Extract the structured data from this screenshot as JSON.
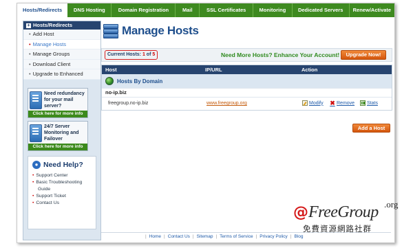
{
  "topnav": {
    "tabs": [
      {
        "label": "Hosts/Redirects",
        "active": true
      },
      {
        "label": "DNS Hosting"
      },
      {
        "label": "Domain Registration"
      },
      {
        "label": "Mail"
      },
      {
        "label": "SSL Certificates"
      },
      {
        "label": "Monitoring"
      },
      {
        "label": "Dedicated Servers"
      },
      {
        "label": "Renew/Activate"
      }
    ]
  },
  "sidebar": {
    "header": "Hosts/Redirects",
    "items": [
      {
        "label": "Add Host"
      },
      {
        "label": "Manage Hosts",
        "active": true
      },
      {
        "label": "Manage Groups"
      },
      {
        "label": "Download Client"
      },
      {
        "label": "Upgrade to Enhanced"
      }
    ],
    "promos": [
      {
        "text": "Need redundancy for your mail server?",
        "button": "Click here for more info"
      },
      {
        "text": "24/7 Server Monitoring and Failover",
        "button": "Click here for more info"
      }
    ],
    "help": {
      "title": "Need Help?",
      "links": [
        "Support Center",
        "Basic Troubleshooting",
        "Guide",
        "Support Ticket",
        "Contact Us"
      ]
    }
  },
  "main": {
    "title": "Manage Hosts",
    "current_hosts": {
      "prefix": "Current Hosts: ",
      "count": "1",
      "of": " of ",
      "limit": "5"
    },
    "upsell": "Need More Hosts? Enhance Your Account!",
    "upgrade_button": "Upgrade Now!",
    "table": {
      "columns": [
        "Host",
        "IP/URL",
        "Action"
      ],
      "section": "Hosts By Domain",
      "group": "no-ip.biz",
      "rows": [
        {
          "host": "freegroup.no-ip.biz",
          "target": "www.freegroup.org",
          "actions": [
            "Modify",
            "Remove",
            "Stats"
          ]
        }
      ]
    },
    "add_host_button": "Add a Host"
  },
  "footer": {
    "links": [
      "Home",
      "Contact Us",
      "Sitemap",
      "Terms of Service",
      "Privacy Policy",
      "Blog"
    ]
  },
  "watermark": {
    "symbol": "@",
    "brand": "FreeGroup",
    "tld": ".org",
    "tagline": "免費資源網路社群"
  },
  "colors": {
    "nav_green": "#3e8a20",
    "header_navy": "#27446f",
    "title_blue": "#1e4e8c",
    "accent_orange": "#e06a1e",
    "alert_red": "#d81f1f"
  }
}
